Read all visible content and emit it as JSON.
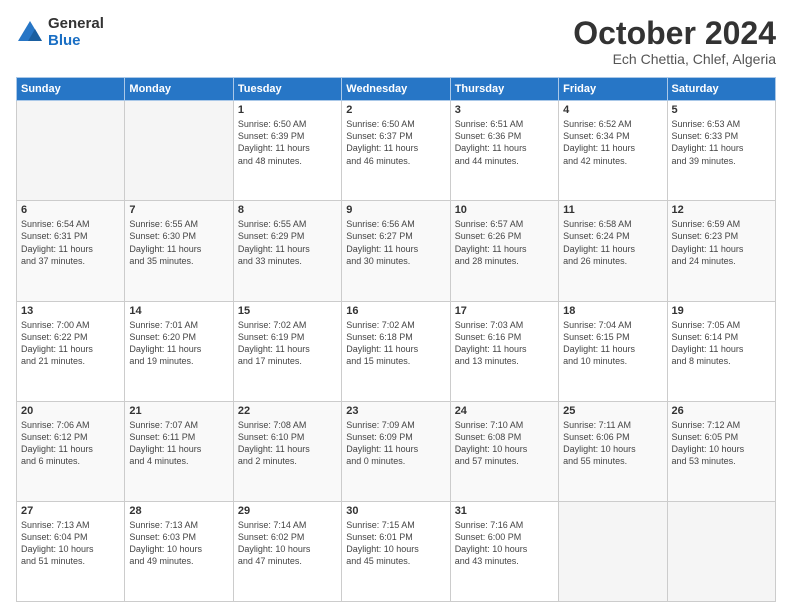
{
  "logo": {
    "general": "General",
    "blue": "Blue"
  },
  "header": {
    "month": "October 2024",
    "location": "Ech Chettia, Chlef, Algeria"
  },
  "weekdays": [
    "Sunday",
    "Monday",
    "Tuesday",
    "Wednesday",
    "Thursday",
    "Friday",
    "Saturday"
  ],
  "weeks": [
    [
      {
        "day": "",
        "info": ""
      },
      {
        "day": "",
        "info": ""
      },
      {
        "day": "1",
        "info": "Sunrise: 6:50 AM\nSunset: 6:39 PM\nDaylight: 11 hours\nand 48 minutes."
      },
      {
        "day": "2",
        "info": "Sunrise: 6:50 AM\nSunset: 6:37 PM\nDaylight: 11 hours\nand 46 minutes."
      },
      {
        "day": "3",
        "info": "Sunrise: 6:51 AM\nSunset: 6:36 PM\nDaylight: 11 hours\nand 44 minutes."
      },
      {
        "day": "4",
        "info": "Sunrise: 6:52 AM\nSunset: 6:34 PM\nDaylight: 11 hours\nand 42 minutes."
      },
      {
        "day": "5",
        "info": "Sunrise: 6:53 AM\nSunset: 6:33 PM\nDaylight: 11 hours\nand 39 minutes."
      }
    ],
    [
      {
        "day": "6",
        "info": "Sunrise: 6:54 AM\nSunset: 6:31 PM\nDaylight: 11 hours\nand 37 minutes."
      },
      {
        "day": "7",
        "info": "Sunrise: 6:55 AM\nSunset: 6:30 PM\nDaylight: 11 hours\nand 35 minutes."
      },
      {
        "day": "8",
        "info": "Sunrise: 6:55 AM\nSunset: 6:29 PM\nDaylight: 11 hours\nand 33 minutes."
      },
      {
        "day": "9",
        "info": "Sunrise: 6:56 AM\nSunset: 6:27 PM\nDaylight: 11 hours\nand 30 minutes."
      },
      {
        "day": "10",
        "info": "Sunrise: 6:57 AM\nSunset: 6:26 PM\nDaylight: 11 hours\nand 28 minutes."
      },
      {
        "day": "11",
        "info": "Sunrise: 6:58 AM\nSunset: 6:24 PM\nDaylight: 11 hours\nand 26 minutes."
      },
      {
        "day": "12",
        "info": "Sunrise: 6:59 AM\nSunset: 6:23 PM\nDaylight: 11 hours\nand 24 minutes."
      }
    ],
    [
      {
        "day": "13",
        "info": "Sunrise: 7:00 AM\nSunset: 6:22 PM\nDaylight: 11 hours\nand 21 minutes."
      },
      {
        "day": "14",
        "info": "Sunrise: 7:01 AM\nSunset: 6:20 PM\nDaylight: 11 hours\nand 19 minutes."
      },
      {
        "day": "15",
        "info": "Sunrise: 7:02 AM\nSunset: 6:19 PM\nDaylight: 11 hours\nand 17 minutes."
      },
      {
        "day": "16",
        "info": "Sunrise: 7:02 AM\nSunset: 6:18 PM\nDaylight: 11 hours\nand 15 minutes."
      },
      {
        "day": "17",
        "info": "Sunrise: 7:03 AM\nSunset: 6:16 PM\nDaylight: 11 hours\nand 13 minutes."
      },
      {
        "day": "18",
        "info": "Sunrise: 7:04 AM\nSunset: 6:15 PM\nDaylight: 11 hours\nand 10 minutes."
      },
      {
        "day": "19",
        "info": "Sunrise: 7:05 AM\nSunset: 6:14 PM\nDaylight: 11 hours\nand 8 minutes."
      }
    ],
    [
      {
        "day": "20",
        "info": "Sunrise: 7:06 AM\nSunset: 6:12 PM\nDaylight: 11 hours\nand 6 minutes."
      },
      {
        "day": "21",
        "info": "Sunrise: 7:07 AM\nSunset: 6:11 PM\nDaylight: 11 hours\nand 4 minutes."
      },
      {
        "day": "22",
        "info": "Sunrise: 7:08 AM\nSunset: 6:10 PM\nDaylight: 11 hours\nand 2 minutes."
      },
      {
        "day": "23",
        "info": "Sunrise: 7:09 AM\nSunset: 6:09 PM\nDaylight: 11 hours\nand 0 minutes."
      },
      {
        "day": "24",
        "info": "Sunrise: 7:10 AM\nSunset: 6:08 PM\nDaylight: 10 hours\nand 57 minutes."
      },
      {
        "day": "25",
        "info": "Sunrise: 7:11 AM\nSunset: 6:06 PM\nDaylight: 10 hours\nand 55 minutes."
      },
      {
        "day": "26",
        "info": "Sunrise: 7:12 AM\nSunset: 6:05 PM\nDaylight: 10 hours\nand 53 minutes."
      }
    ],
    [
      {
        "day": "27",
        "info": "Sunrise: 7:13 AM\nSunset: 6:04 PM\nDaylight: 10 hours\nand 51 minutes."
      },
      {
        "day": "28",
        "info": "Sunrise: 7:13 AM\nSunset: 6:03 PM\nDaylight: 10 hours\nand 49 minutes."
      },
      {
        "day": "29",
        "info": "Sunrise: 7:14 AM\nSunset: 6:02 PM\nDaylight: 10 hours\nand 47 minutes."
      },
      {
        "day": "30",
        "info": "Sunrise: 7:15 AM\nSunset: 6:01 PM\nDaylight: 10 hours\nand 45 minutes."
      },
      {
        "day": "31",
        "info": "Sunrise: 7:16 AM\nSunset: 6:00 PM\nDaylight: 10 hours\nand 43 minutes."
      },
      {
        "day": "",
        "info": ""
      },
      {
        "day": "",
        "info": ""
      }
    ]
  ]
}
